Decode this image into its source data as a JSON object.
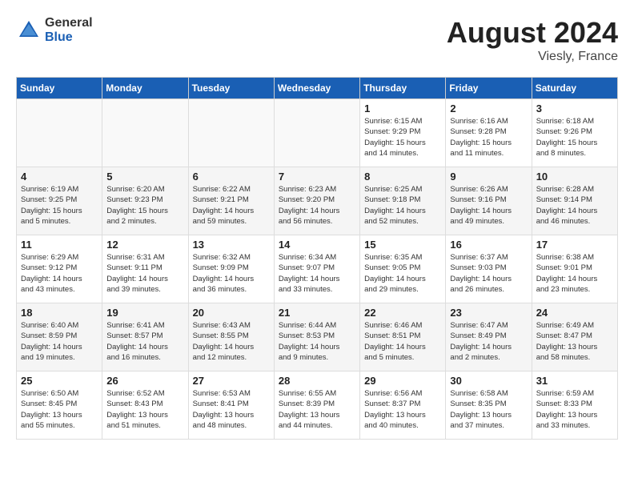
{
  "header": {
    "logo_general": "General",
    "logo_blue": "Blue",
    "month_title": "August 2024",
    "location": "Viesly, France"
  },
  "days_of_week": [
    "Sunday",
    "Monday",
    "Tuesday",
    "Wednesday",
    "Thursday",
    "Friday",
    "Saturday"
  ],
  "weeks": [
    [
      {
        "day": "",
        "info": ""
      },
      {
        "day": "",
        "info": ""
      },
      {
        "day": "",
        "info": ""
      },
      {
        "day": "",
        "info": ""
      },
      {
        "day": "1",
        "info": "Sunrise: 6:15 AM\nSunset: 9:29 PM\nDaylight: 15 hours\nand 14 minutes."
      },
      {
        "day": "2",
        "info": "Sunrise: 6:16 AM\nSunset: 9:28 PM\nDaylight: 15 hours\nand 11 minutes."
      },
      {
        "day": "3",
        "info": "Sunrise: 6:18 AM\nSunset: 9:26 PM\nDaylight: 15 hours\nand 8 minutes."
      }
    ],
    [
      {
        "day": "4",
        "info": "Sunrise: 6:19 AM\nSunset: 9:25 PM\nDaylight: 15 hours\nand 5 minutes."
      },
      {
        "day": "5",
        "info": "Sunrise: 6:20 AM\nSunset: 9:23 PM\nDaylight: 15 hours\nand 2 minutes."
      },
      {
        "day": "6",
        "info": "Sunrise: 6:22 AM\nSunset: 9:21 PM\nDaylight: 14 hours\nand 59 minutes."
      },
      {
        "day": "7",
        "info": "Sunrise: 6:23 AM\nSunset: 9:20 PM\nDaylight: 14 hours\nand 56 minutes."
      },
      {
        "day": "8",
        "info": "Sunrise: 6:25 AM\nSunset: 9:18 PM\nDaylight: 14 hours\nand 52 minutes."
      },
      {
        "day": "9",
        "info": "Sunrise: 6:26 AM\nSunset: 9:16 PM\nDaylight: 14 hours\nand 49 minutes."
      },
      {
        "day": "10",
        "info": "Sunrise: 6:28 AM\nSunset: 9:14 PM\nDaylight: 14 hours\nand 46 minutes."
      }
    ],
    [
      {
        "day": "11",
        "info": "Sunrise: 6:29 AM\nSunset: 9:12 PM\nDaylight: 14 hours\nand 43 minutes."
      },
      {
        "day": "12",
        "info": "Sunrise: 6:31 AM\nSunset: 9:11 PM\nDaylight: 14 hours\nand 39 minutes."
      },
      {
        "day": "13",
        "info": "Sunrise: 6:32 AM\nSunset: 9:09 PM\nDaylight: 14 hours\nand 36 minutes."
      },
      {
        "day": "14",
        "info": "Sunrise: 6:34 AM\nSunset: 9:07 PM\nDaylight: 14 hours\nand 33 minutes."
      },
      {
        "day": "15",
        "info": "Sunrise: 6:35 AM\nSunset: 9:05 PM\nDaylight: 14 hours\nand 29 minutes."
      },
      {
        "day": "16",
        "info": "Sunrise: 6:37 AM\nSunset: 9:03 PM\nDaylight: 14 hours\nand 26 minutes."
      },
      {
        "day": "17",
        "info": "Sunrise: 6:38 AM\nSunset: 9:01 PM\nDaylight: 14 hours\nand 23 minutes."
      }
    ],
    [
      {
        "day": "18",
        "info": "Sunrise: 6:40 AM\nSunset: 8:59 PM\nDaylight: 14 hours\nand 19 minutes."
      },
      {
        "day": "19",
        "info": "Sunrise: 6:41 AM\nSunset: 8:57 PM\nDaylight: 14 hours\nand 16 minutes."
      },
      {
        "day": "20",
        "info": "Sunrise: 6:43 AM\nSunset: 8:55 PM\nDaylight: 14 hours\nand 12 minutes."
      },
      {
        "day": "21",
        "info": "Sunrise: 6:44 AM\nSunset: 8:53 PM\nDaylight: 14 hours\nand 9 minutes."
      },
      {
        "day": "22",
        "info": "Sunrise: 6:46 AM\nSunset: 8:51 PM\nDaylight: 14 hours\nand 5 minutes."
      },
      {
        "day": "23",
        "info": "Sunrise: 6:47 AM\nSunset: 8:49 PM\nDaylight: 14 hours\nand 2 minutes."
      },
      {
        "day": "24",
        "info": "Sunrise: 6:49 AM\nSunset: 8:47 PM\nDaylight: 13 hours\nand 58 minutes."
      }
    ],
    [
      {
        "day": "25",
        "info": "Sunrise: 6:50 AM\nSunset: 8:45 PM\nDaylight: 13 hours\nand 55 minutes."
      },
      {
        "day": "26",
        "info": "Sunrise: 6:52 AM\nSunset: 8:43 PM\nDaylight: 13 hours\nand 51 minutes."
      },
      {
        "day": "27",
        "info": "Sunrise: 6:53 AM\nSunset: 8:41 PM\nDaylight: 13 hours\nand 48 minutes."
      },
      {
        "day": "28",
        "info": "Sunrise: 6:55 AM\nSunset: 8:39 PM\nDaylight: 13 hours\nand 44 minutes."
      },
      {
        "day": "29",
        "info": "Sunrise: 6:56 AM\nSunset: 8:37 PM\nDaylight: 13 hours\nand 40 minutes."
      },
      {
        "day": "30",
        "info": "Sunrise: 6:58 AM\nSunset: 8:35 PM\nDaylight: 13 hours\nand 37 minutes."
      },
      {
        "day": "31",
        "info": "Sunrise: 6:59 AM\nSunset: 8:33 PM\nDaylight: 13 hours\nand 33 minutes."
      }
    ]
  ]
}
